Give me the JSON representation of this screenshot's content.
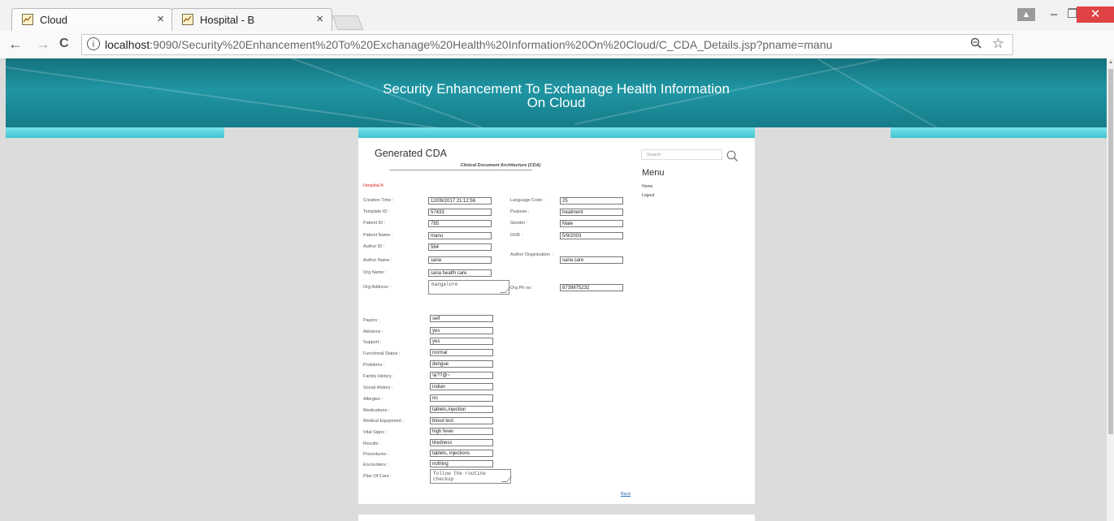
{
  "browser": {
    "tabs": [
      {
        "title": "Cloud",
        "close": "×"
      },
      {
        "title": "Hospital - B",
        "close": "×"
      }
    ],
    "url_host": "localhost",
    "url_rest": ":9090/Security%20Enhancement%20To%20Exchanage%20Health%20Information%20On%20Cloud/C_CDA_Details.jsp?pname=manu",
    "nav": {
      "back": "←",
      "forward": "→",
      "reload": "C"
    },
    "window": {
      "minimize": "–",
      "maximize": "❐",
      "close": "✕"
    }
  },
  "site": {
    "title_line1": "Security Enhancement To Exchanage Health Information",
    "title_line2": "On Cloud"
  },
  "cda": {
    "heading": "Generated CDA",
    "subtitle": "Clinical Document Architecture (CDA)",
    "separator": "------------------------------------------------------------------------------------------------",
    "hospital": "Hospital A",
    "fields": [
      {
        "label": "Creation Time :",
        "value": "12/09/2017  21:12:56"
      },
      {
        "label": "Language Code :",
        "value": "25"
      },
      {
        "label": "Template ID :",
        "value": "57433"
      },
      {
        "label": "Purpose :",
        "value": "treatment"
      },
      {
        "label": "Patient ID :",
        "value": "785"
      },
      {
        "label": "Gender :",
        "value": "Male"
      },
      {
        "label": "Patient Name :",
        "value": "manu"
      },
      {
        "label": "DOB :",
        "value": "5/9/2003"
      },
      {
        "label": "Author ID :",
        "value": "564"
      },
      {
        "label": "Author Name :",
        "value": "sana"
      },
      {
        "label": "Author Organization :",
        "value": "sana care"
      },
      {
        "label": "Org Name :",
        "value": "sana health care"
      },
      {
        "label": "Org Address :",
        "value": "bangalore"
      },
      {
        "label": "Org Ph no :",
        "value": "8739875232"
      }
    ],
    "clinical": [
      {
        "label": "Payers :",
        "value": "self"
      },
      {
        "label": "Advance :",
        "value": "yes"
      },
      {
        "label": "Support :",
        "value": "yes"
      },
      {
        "label": "Functional Status :",
        "value": "normal"
      },
      {
        "label": "Problems :",
        "value": "dengue"
      },
      {
        "label": "Family History :",
        "value": "\\&??@~"
      },
      {
        "label": "Social History :",
        "value": "indian"
      },
      {
        "label": "Allergies :",
        "value": "no"
      },
      {
        "label": "Medications :",
        "value": "tablets,injection"
      },
      {
        "label": "Medical Equipment :",
        "value": "blood test"
      },
      {
        "label": "Vital Signs :",
        "value": "high fever"
      },
      {
        "label": "Results :",
        "value": "tiredness"
      },
      {
        "label": "Procedures :",
        "value": "tablets, injections"
      },
      {
        "label": "Encounters :",
        "value": "nothing"
      },
      {
        "label": "Plan Of Care :",
        "value": "follow the routine checkup"
      }
    ],
    "back": "Back"
  },
  "sidebar": {
    "search_placeholder": "Search",
    "menu_title": "Menu",
    "links": [
      "Home",
      "Logout"
    ]
  },
  "icons": [
    "page-favicon-icon",
    "info-icon",
    "zoom-icon",
    "star-icon",
    "extension-icon",
    "search-icon"
  ],
  "colors": {
    "header": "#1a8795",
    "strip": "#5fd3de",
    "hospital_label": "#dd2222",
    "link": "#2a6fb8"
  }
}
